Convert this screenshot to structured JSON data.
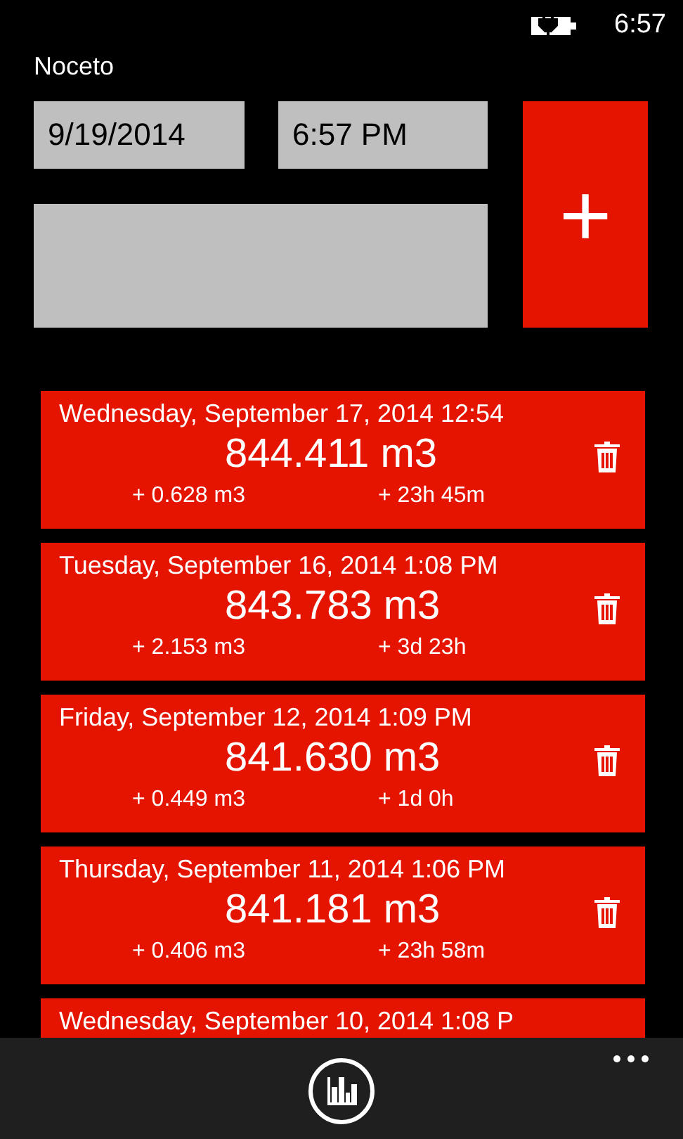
{
  "status_bar": {
    "time": "6:57"
  },
  "app_title": "Noceto",
  "date_field": {
    "value": "9/19/2014"
  },
  "time_field": {
    "value": "6:57 PM"
  },
  "add_button": {
    "label": "+"
  },
  "entries": [
    {
      "timestamp": "Wednesday, September 17, 2014 12:54",
      "reading": "844.411 m3",
      "volume_delta": "+ 0.628 m3",
      "time_delta": "+ 23h 45m"
    },
    {
      "timestamp": "Tuesday, September 16, 2014 1:08 PM",
      "reading": "843.783 m3",
      "volume_delta": "+ 2.153 m3",
      "time_delta": "+ 3d 23h"
    },
    {
      "timestamp": "Friday, September 12, 2014 1:09 PM",
      "reading": "841.630 m3",
      "volume_delta": "+ 0.449 m3",
      "time_delta": "+ 1d 0h"
    },
    {
      "timestamp": "Thursday, September 11, 2014 1:06 PM",
      "reading": "841.181 m3",
      "volume_delta": "+ 0.406 m3",
      "time_delta": "+ 23h 58m"
    },
    {
      "timestamp": "Wednesday, September 10, 2014 1:08 P"
    }
  ]
}
